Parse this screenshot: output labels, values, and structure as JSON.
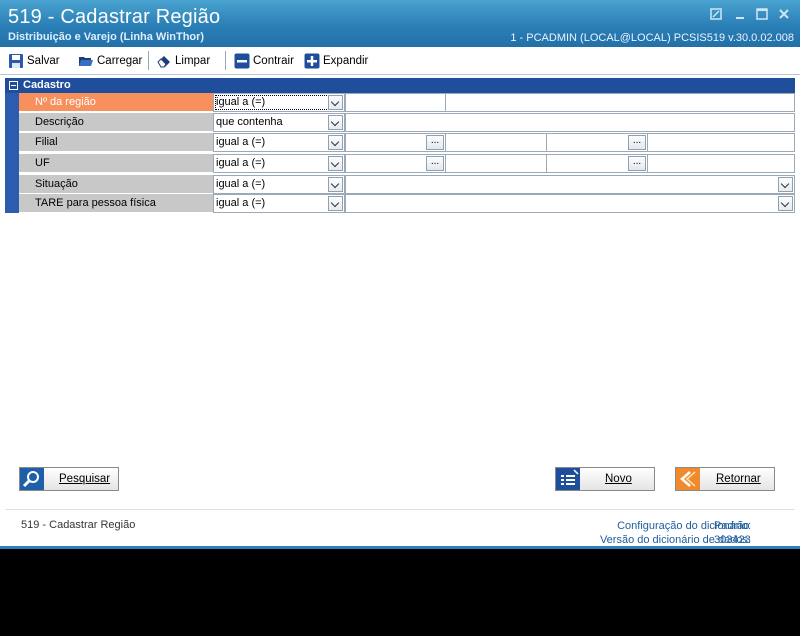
{
  "window": {
    "title": "519 - Cadastrar Região",
    "subtitle": "Distribuição e Varejo (Linha WinThor)",
    "sysinfo": "1 - PCADMIN (LOCAL@LOCAL)   PCSIS519  v.30.0.02.008",
    "controls": [
      "restore-icon",
      "minimize-icon",
      "maximize-icon",
      "close-icon"
    ]
  },
  "toolbar": {
    "save_label": "Salvar",
    "load_label": "Carregar",
    "clear_label": "Limpar",
    "collapse_label": "Contrair",
    "expand_label": "Expandir"
  },
  "group": {
    "title": "Cadastro"
  },
  "filters": [
    {
      "label": "Nº da região",
      "operator": "igual a (=)"
    },
    {
      "label": "Descrição",
      "operator": "que contenha"
    },
    {
      "label": "Filial",
      "operator": "igual a (=)",
      "lookup_button": "..."
    },
    {
      "label": "UF",
      "operator": "igual a (=)",
      "lookup_button": "..."
    },
    {
      "label": "Situação",
      "operator": "igual a (=)"
    },
    {
      "label": "TARE para pessoa física",
      "operator": "igual a (=)"
    }
  ],
  "buttons": {
    "search_label": "Pesquisar",
    "new_label": "Novo",
    "return_label": "Retornar"
  },
  "status": {
    "left": "519 - Cadastrar Região",
    "dict_config_label": "Configuração do dicionário:",
    "dict_config_value": "Padrão",
    "dict_version_label": "Versão do dicionário de dados:",
    "dict_version_value": "303423"
  },
  "colors": {
    "titlebar": "#2a7fb6",
    "group_header": "#1f4f9c",
    "selected_label": "#f7905c",
    "label_cell": "#c8c8c8",
    "status_link": "#1d5e9c"
  }
}
